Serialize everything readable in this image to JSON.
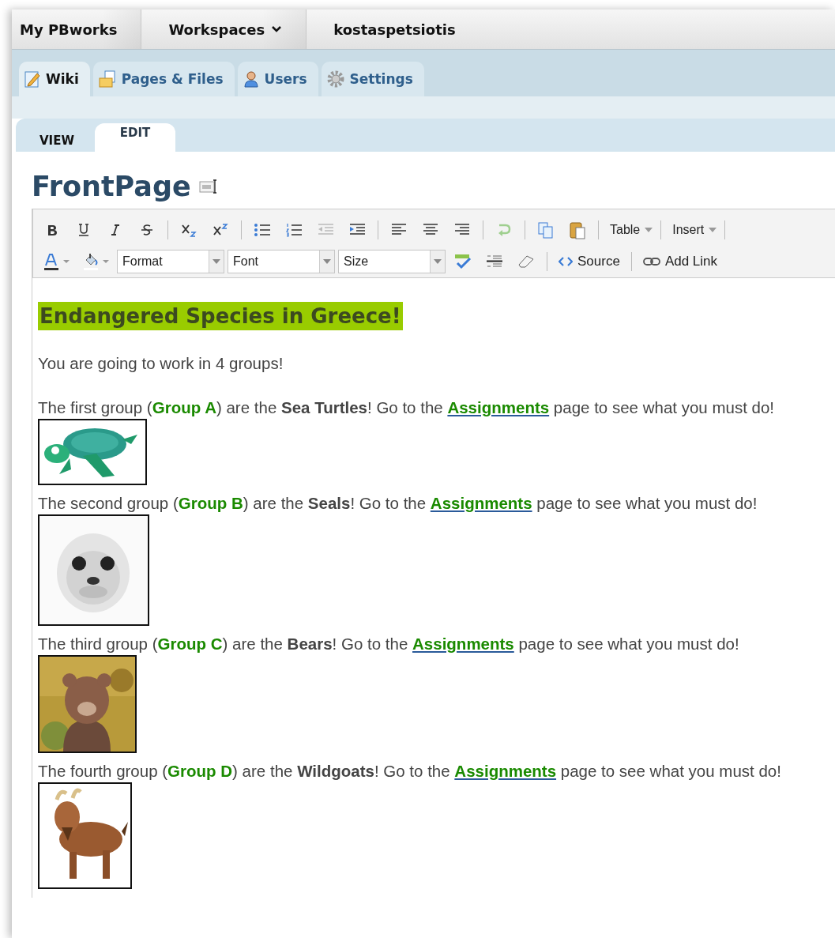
{
  "breadcrumb": [
    {
      "label": "My PBworks",
      "dropdown": false
    },
    {
      "label": "Workspaces",
      "dropdown": true
    },
    {
      "label": "kostaspetsiotis",
      "dropdown": false
    }
  ],
  "nav_tabs": [
    {
      "label": "Wiki",
      "selected": true
    },
    {
      "label": "Pages & Files",
      "selected": false
    },
    {
      "label": "Users",
      "selected": false
    },
    {
      "label": "Settings",
      "selected": false
    }
  ],
  "mode_tabs": [
    {
      "label": "VIEW",
      "selected": false
    },
    {
      "label": "EDIT",
      "selected": true
    }
  ],
  "page_title": "FrontPage",
  "toolbar": {
    "menus": [
      "Table",
      "Insert"
    ],
    "selects": [
      "Format",
      "Font",
      "Size"
    ],
    "source": "Source",
    "add_link": "Add Link"
  },
  "heading": "Endangered Species in Greece!",
  "intro": "You are going to work in 4 groups!",
  "groups": [
    {
      "prefix": "The first group (",
      "group": "Group A",
      "mid": ") are the ",
      "animal": "Sea Turtles",
      "go": "! Go to the ",
      "link": "Assignments",
      "suffix": " page to see what you must do!"
    },
    {
      "prefix": "The second group (",
      "group": "Group B",
      "mid": ") are the ",
      "animal": "Seals",
      "go": "! Go to the ",
      "link": "Assignments",
      "suffix": " page to see what you must do!"
    },
    {
      "prefix": "The third group (",
      "group": "Group C",
      "mid": ") are the ",
      "animal": "Bears",
      "go": "! Go to the ",
      "link": "Assignments",
      "suffix": " page to see what you must do!"
    },
    {
      "prefix": "The fourth group (",
      "group": "Group D",
      "mid": ") are the ",
      "animal": "Wildgoats",
      "go": "! Go to the ",
      "link": "Assignments",
      "suffix": " page to see what you must do!"
    }
  ]
}
